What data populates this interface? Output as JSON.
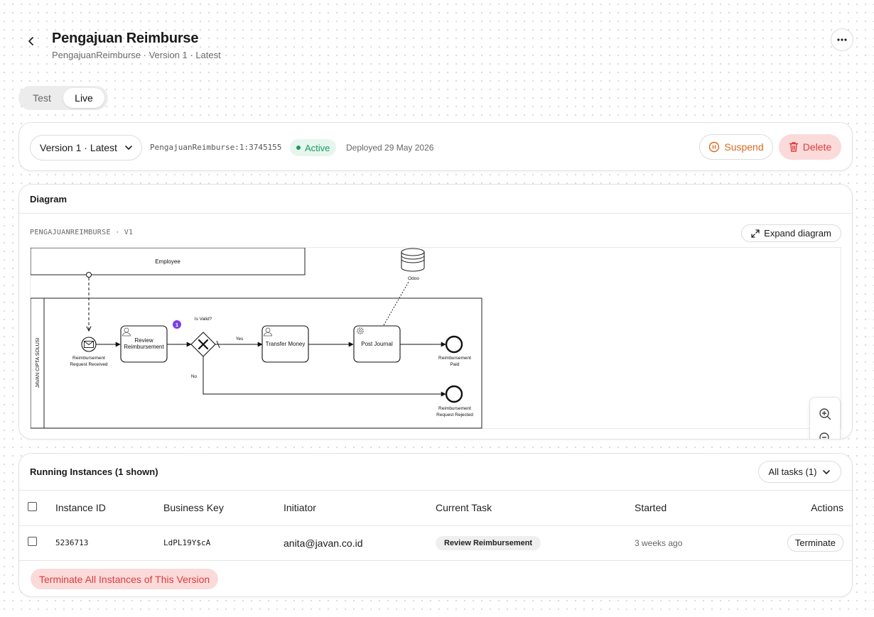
{
  "header": {
    "title": "Pengajuan Reimburse",
    "subtitle": "PengajuanReimburse · Version 1 · Latest"
  },
  "env_tabs": {
    "test": "Test",
    "live": "Live",
    "active": "Live"
  },
  "version_bar": {
    "selected_version": "Version 1 · Latest",
    "process_key": "PengajuanReimburse:1:3745155",
    "status": "Active",
    "deployed": "Deployed 29 May 2026",
    "suspend_label": "Suspend",
    "delete_label": "Delete"
  },
  "diagram": {
    "heading": "Diagram",
    "caption": "PENGAJUANREIMBURSE · V1",
    "expand_label": "Expand diagram",
    "nodes": {
      "employee_pool": "Employee",
      "odoo": "Odoo",
      "lane": "JAVAN CIPTA SOLUSI",
      "start_line1": "Reimbursement",
      "start_line2": "Request Received",
      "review_line1": "Review",
      "review_line2": "Reimbursement",
      "review_badge": "1",
      "gateway_label": "Is Valid?",
      "yes_label": "Yes",
      "no_label": "No",
      "transfer": "Transfer Money",
      "post_journal": "Post Journal",
      "paid_line1": "Reimbursement",
      "paid_line2": "Paid",
      "rejected_line1": "Reimbursement",
      "rejected_line2": "Request Rejected"
    }
  },
  "instances": {
    "title": "Running Instances (1 shown)",
    "filter_label": "All tasks (1)",
    "columns": {
      "instance_id": "Instance ID",
      "business_key": "Business Key",
      "initiator": "Initiator",
      "current_task": "Current Task",
      "started": "Started",
      "actions": "Actions"
    },
    "rows": [
      {
        "instance_id": "5236713",
        "business_key": "LdPL19Y$cA",
        "initiator": "anita@javan.co.id",
        "current_task": "Review Reimbursement",
        "started": "3 weeks ago",
        "action": "Terminate"
      }
    ],
    "terminate_all_label": "Terminate All Instances of This Version"
  },
  "colors": {
    "active_green": "#1a9a5a",
    "suspend_orange": "#d86a1e",
    "danger_red": "#de3b3b",
    "danger_bg": "#fbdada",
    "badge_purple": "#7b3fe4"
  }
}
